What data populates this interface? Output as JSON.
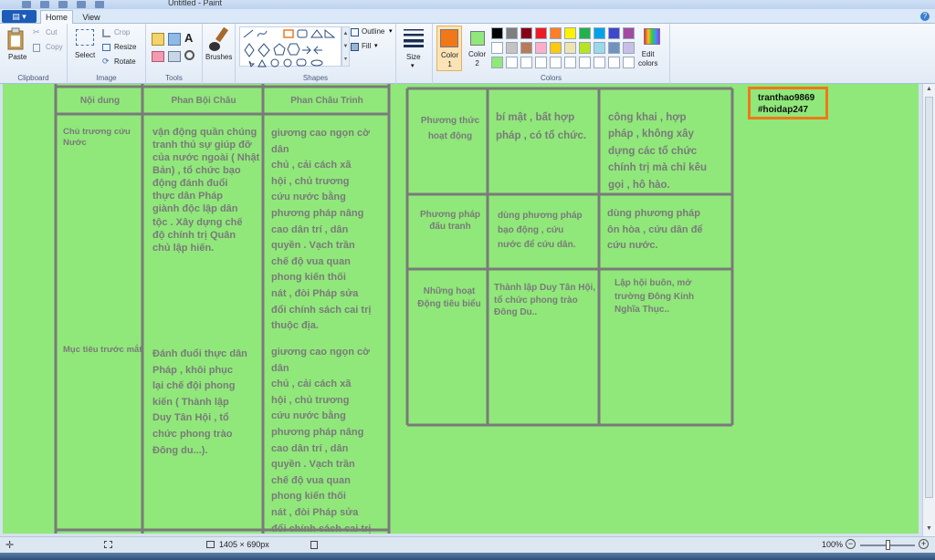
{
  "window": {
    "title": "Untitled - Paint"
  },
  "tabs": {
    "file": "▤ ▾",
    "home": "Home",
    "view": "View",
    "help": "?"
  },
  "clipboard": {
    "paste": "Paste",
    "cut": "Cut",
    "copy": "Copy",
    "label": "Clipboard"
  },
  "image": {
    "select": "Select",
    "crop": "Crop",
    "resize": "Resize",
    "rotate": "Rotate",
    "label": "Image"
  },
  "tools": {
    "label": "Tools"
  },
  "brushes": {
    "label": "Brushes"
  },
  "shapes": {
    "label": "Shapes",
    "outline": "Outline",
    "fill": "Fill"
  },
  "size": {
    "label": "Size"
  },
  "colors": {
    "color1_label": "Color\n1",
    "color2_label": "Color\n2",
    "edit_label": "Edit\ncolors",
    "group_label": "Colors",
    "color1": "#f07818",
    "color2": "#90e87a",
    "palette": [
      "#000000",
      "#7f7f7f",
      "#880015",
      "#ed1c24",
      "#ff7f27",
      "#fff200",
      "#22b14c",
      "#00a2e8",
      "#3f48cc",
      "#a349a4",
      "#ffffff",
      "#c3c3c3",
      "#b97a57",
      "#ffaec9",
      "#ffc90e",
      "#efe4b0",
      "#b5e61d",
      "#99d9ea",
      "#7092be",
      "#c8bfe7",
      "#90e87a",
      "#ffffff",
      "#ffffff",
      "#ffffff",
      "#ffffff",
      "#ffffff",
      "#ffffff",
      "#ffffff",
      "#ffffff",
      "#ffffff"
    ]
  },
  "canvas": {
    "bg": "#90e87a",
    "left_table": {
      "headers": [
        "Nội dung",
        "Phan Bội Châu",
        "Phan Châu Trinh"
      ],
      "rows": [
        {
          "label": "Chủ trương cứu\nNước",
          "pbc": "vận động quần chúng\ntranh thủ sự giúp đỡ\ncủa nước ngoài ( Nhật\nBản) ,  tổ chức bạo\nđộng đánh đuổi\nthực dân Pháp\ngiành độc lập dân\ntộc . Xây dựng chế\nđộ chính trị Quân\nchủ lập hiến.",
          "pct": "giương cao ngọn cờ dân\nchủ ,  cải cách xã\nhội ,  chủ trương\ncứu nước bằng\nphương pháp nâng\ncao dân trí ,  dân\nquyền . Vạch trần\nchế độ vua quan\nphong kiến thối\nnát ,  đòi Pháp sửa\nđổi chính sách cai trị\nthuộc địa."
        },
        {
          "label": "Mục tiêu trước mắt",
          "pbc": "Đánh đuổi thực dân\nPháp ,  khôi phục\nlại chế đội phong\nkiến ( Thành lập\nDuy Tân Hội ,  tổ\nchức phong trào\nĐông du...).",
          "pct": "giương cao ngọn cờ dân\nchủ ,  cải cách xã\nhội ,  chủ trương\ncứu nước bằng\nphương pháp nâng\ncao dân trí ,  dân\nquyền . Vạch trần\nchế độ vua quan\nphong kiến thối\nnát ,  đòi Pháp sửa\nđổi chính sách cai trị\nthuộc địa."
        }
      ]
    },
    "right_table": {
      "rows": [
        {
          "label": "Phương  thức\nhoạt động",
          "pbc": "bí mật ,  bất hợp\npháp ,  có tổ chức.",
          "pct": "công khai ,  hợp\npháp ,  không xây\ndựng các tổ chức\nchính trị mà chỉ kêu\ngọi ,  hô hào."
        },
        {
          "label": "Phương  pháp\nđấu tranh",
          "pbc": "dùng phương pháp\nbạo động ,  cứu\nnước để cứu dân.",
          "pct": " dùng phương pháp\nôn hòa ,  cứu dân để\ncứu nước."
        },
        {
          "label": "Những hoạt\nĐộng tiêu biểu",
          "pbc": "Thành lập Duy Tân Hội,\ntổ chức phong trào\nĐông Du..",
          "pct": "Lập hội buôn, mở\ntrường Đông Kinh\nNghĩa Thục.."
        }
      ]
    },
    "note": {
      "line1": "tranthao9869",
      "line2": "#hoidap247"
    }
  },
  "status": {
    "dimensions": "1405 × 690px",
    "zoom": "100%"
  }
}
